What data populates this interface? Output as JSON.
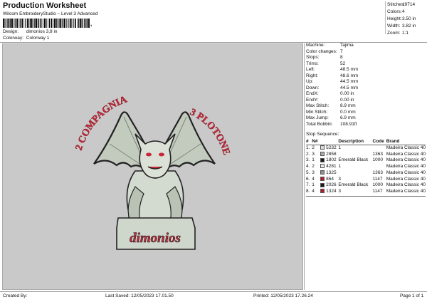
{
  "header": {
    "title": "Production Worksheet",
    "subtitle": "Wilcom EmbroideryStudio – Level 3 Advanced",
    "design_label": "Design:",
    "design_value": "dimonios 3,8 in",
    "colorway_label": "Colorway:",
    "colorway_value": "Colorway 1"
  },
  "stats": [
    {
      "label": "Stitches:",
      "value": "19714"
    },
    {
      "label": "Colors:",
      "value": "4"
    },
    {
      "label": "Height:",
      "value": "3.50 in"
    },
    {
      "label": "Width:",
      "value": "3.82 in"
    },
    {
      "label": "Zoom:",
      "value": "1:1"
    }
  ],
  "params": [
    {
      "label": "Machine:",
      "value": "Tajima"
    },
    {
      "label": "Color changes:",
      "value": "7"
    },
    {
      "label": "Stops:",
      "value": "8"
    },
    {
      "label": "Trims:",
      "value": "52"
    },
    {
      "label": "Left:",
      "value": "48.5 mm"
    },
    {
      "label": "Right:",
      "value": "48.6 mm"
    },
    {
      "label": "Up:",
      "value": "44.5 mm"
    },
    {
      "label": "Down:",
      "value": "44.5 mm"
    },
    {
      "label": "EndX:",
      "value": "0.00 in"
    },
    {
      "label": "EndY:",
      "value": "0.00 in"
    },
    {
      "label": "Max Stitch:",
      "value": "8.9 mm"
    },
    {
      "label": "Min Stitch:",
      "value": "0.0 mm"
    },
    {
      "label": "Max Jump:",
      "value": "6.9 mm"
    },
    {
      "label": "Total Bobbin:",
      "value": "108.91ft"
    }
  ],
  "stop_sequence": {
    "title": "Stop Sequence:",
    "headers": [
      "#",
      "N#",
      "",
      "Description",
      "Code",
      "Brand"
    ],
    "rows": [
      {
        "num": "1.",
        "n": "2",
        "color": "#d6dcd2",
        "code_num": "5232",
        "desc": "1",
        "code": "",
        "brand": "Madeira Classic 40"
      },
      {
        "num": "2.",
        "n": "3",
        "color": "#a7aaa5",
        "code_num": "2858",
        "desc": "",
        "code": "1363",
        "brand": "Madeira Classic 40"
      },
      {
        "num": "3.",
        "n": "1",
        "color": "#1a1a1a",
        "code_num": "1802",
        "desc": "Emerald Black",
        "code": "1000",
        "brand": "Madeira Classic 40"
      },
      {
        "num": "4.",
        "n": "2",
        "color": "#e6e9e3",
        "code_num": "4281",
        "desc": "1",
        "code": "",
        "brand": "Madeira Classic 40"
      },
      {
        "num": "5.",
        "n": "3",
        "color": "#8f918c",
        "code_num": "1325",
        "desc": "",
        "code": "1363",
        "brand": "Madeira Classic 40"
      },
      {
        "num": "6.",
        "n": "4",
        "color": "#b31b2c",
        "code_num": "864",
        "desc": "3",
        "code": "1147",
        "brand": "Madeira Classic 40"
      },
      {
        "num": "7.",
        "n": "1",
        "color": "#1a1a1a",
        "code_num": "2026",
        "desc": "Emerald Black",
        "code": "1000",
        "brand": "Madeira Classic 40"
      },
      {
        "num": "8.",
        "n": "4",
        "color": "#b31b2c",
        "code_num": "1324",
        "desc": "3",
        "code": "1147",
        "brand": "Madeira Classic 40"
      }
    ]
  },
  "artwork": {
    "arc_left": "2 COMPAGNIA",
    "arc_right": "3 PLOTONE",
    "banner": "dimonios",
    "colors": {
      "red": "#c8283a",
      "green_light": "#d7ddd3",
      "green_mid": "#aeb7aa",
      "outline": "#222222"
    }
  },
  "footer": {
    "created_by": "Created By:",
    "last_saved": "Last Saved: 12/05/2023 17.01.50",
    "printed": "Printed: 12/05/2023 17.26.24",
    "page": "Page 1 of 1"
  }
}
